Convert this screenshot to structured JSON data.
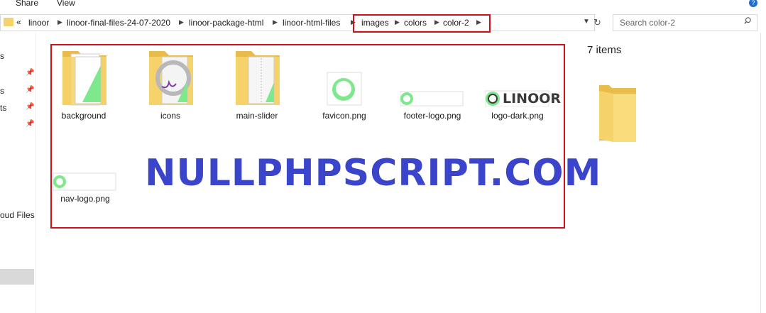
{
  "ribbon": {
    "tabs": [
      "Share",
      "View"
    ]
  },
  "address": {
    "root_glyph": "«",
    "crumbs": [
      "linoor",
      "linoor-final-files-24-07-2020",
      "linoor-package-html",
      "linoor-html-files",
      "images",
      "colors",
      "color-2"
    ]
  },
  "search": {
    "placeholder": "Search color-2"
  },
  "sidebar": {
    "items": [
      "s",
      "s",
      "ts",
      "oud Files"
    ]
  },
  "files": [
    {
      "name": "background",
      "kind": "folder"
    },
    {
      "name": "icons",
      "kind": "folder"
    },
    {
      "name": "main-slider",
      "kind": "folder"
    },
    {
      "name": "favicon.png",
      "kind": "image"
    },
    {
      "name": "footer-logo.png",
      "kind": "image"
    },
    {
      "name": "logo-dark.png",
      "kind": "image"
    },
    {
      "name": "nav-logo.png",
      "kind": "image"
    }
  ],
  "logo_text": "LINOOR",
  "status": {
    "item_count": "7 items"
  },
  "watermark": "NULLPHPSCRIPT.COM",
  "colors": {
    "highlight": "#d0101a",
    "accent_green": "#7de88c",
    "folder": "#f6d36a",
    "watermark": "#3a45cc"
  }
}
